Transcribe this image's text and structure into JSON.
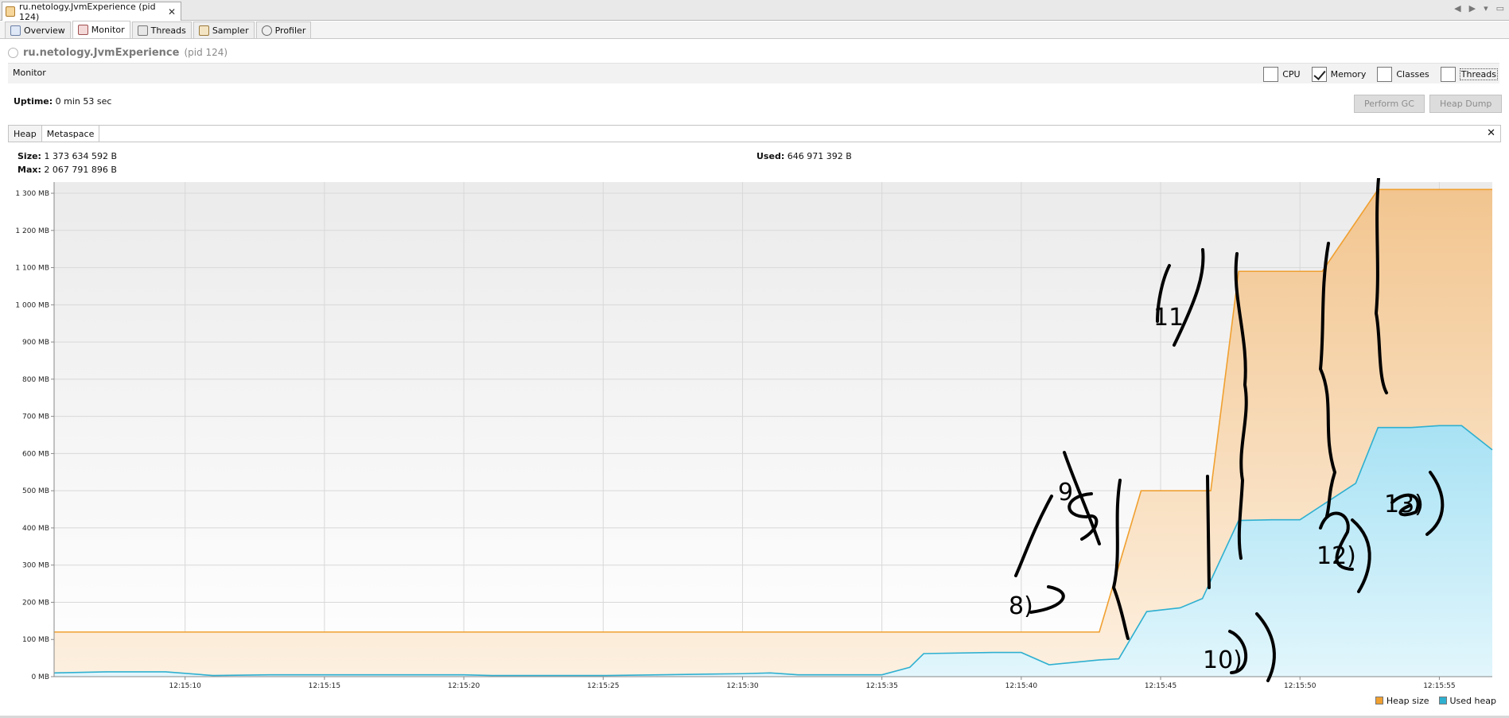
{
  "window": {
    "doc_tab_title": "ru.netology.JvmExperience (pid 124)",
    "close_glyph": "✕",
    "controls": [
      "◀",
      "▶",
      "▾",
      "▭"
    ]
  },
  "subtabs": [
    {
      "label": "Overview",
      "icon": "overview-icon"
    },
    {
      "label": "Monitor",
      "icon": "monitor-icon",
      "active": true
    },
    {
      "label": "Threads",
      "icon": "threads-icon"
    },
    {
      "label": "Sampler",
      "icon": "sampler-icon"
    },
    {
      "label": "Profiler",
      "icon": "profiler-icon"
    }
  ],
  "app": {
    "name": "ru.netology.JvmExperience",
    "pid": "(pid 124)"
  },
  "monitor": {
    "title": "Monitor",
    "checks": [
      {
        "label": "CPU",
        "checked": false
      },
      {
        "label": "Memory",
        "checked": true
      },
      {
        "label": "Classes",
        "checked": false
      },
      {
        "label": "Threads",
        "checked": false
      }
    ],
    "uptime_label": "Uptime:",
    "uptime_value": "0 min 53 sec",
    "perform_gc": "Perform GC",
    "heap_dump": "Heap Dump"
  },
  "heap": {
    "tabs": [
      "Heap",
      "Metaspace"
    ],
    "close_glyph": "✕",
    "size_label": "Size:",
    "size_value": "1 373 634 592 B",
    "max_label": "Max:",
    "max_value": "2 067 791 896 B",
    "used_label": "Used:",
    "used_value": "646 971 392 B"
  },
  "colors": {
    "heap_size": "#f0a030",
    "used_heap": "#2fb0d0"
  },
  "chart_data": {
    "type": "area",
    "y_ticks": [
      "0 MB",
      "100 MB",
      "200 MB",
      "300 MB",
      "400 MB",
      "500 MB",
      "600 MB",
      "700 MB",
      "800 MB",
      "900 MB",
      "1 000 MB",
      "1 100 MB",
      "1 200 MB",
      "1 300 MB"
    ],
    "x_ticks": [
      "12:15:10",
      "12:15:15",
      "12:15:20",
      "12:15:25",
      "12:15:30",
      "12:15:35",
      "12:15:40",
      "12:15:45",
      "12:15:50",
      "12:15:55"
    ],
    "ylim": [
      0,
      1330
    ],
    "x_unit_note_hidden": true,
    "series": [
      {
        "name": "Heap size",
        "x": [
          5.3,
          42.8,
          44.3,
          46.8,
          47.8,
          50.8,
          52.8,
          56.9
        ],
        "values": [
          120,
          120,
          500,
          500,
          1090,
          1090,
          1310,
          1310
        ]
      },
      {
        "name": "Used heap",
        "x": [
          5.3,
          6.5,
          7.2,
          9.3,
          11,
          13,
          20,
          21,
          25,
          27,
          30,
          31,
          32,
          35,
          36,
          36.5,
          39,
          40,
          41,
          42.8,
          43.5,
          44.5,
          45.7,
          46.5,
          47.8,
          49,
          50,
          52,
          52.8,
          54,
          55,
          55.8,
          56.9
        ],
        "values": [
          10,
          12,
          13,
          13,
          3,
          5,
          5,
          3,
          3,
          5,
          8,
          10,
          5,
          5,
          25,
          62,
          65,
          65,
          32,
          45,
          48,
          175,
          185,
          210,
          420,
          422,
          422,
          520,
          670,
          670,
          675,
          675,
          610
        ]
      }
    ],
    "grid": true,
    "legend_position": "bottom-right"
  },
  "annotations": [
    "8)",
    "9",
    "10)",
    "11",
    "12)",
    "13)"
  ]
}
